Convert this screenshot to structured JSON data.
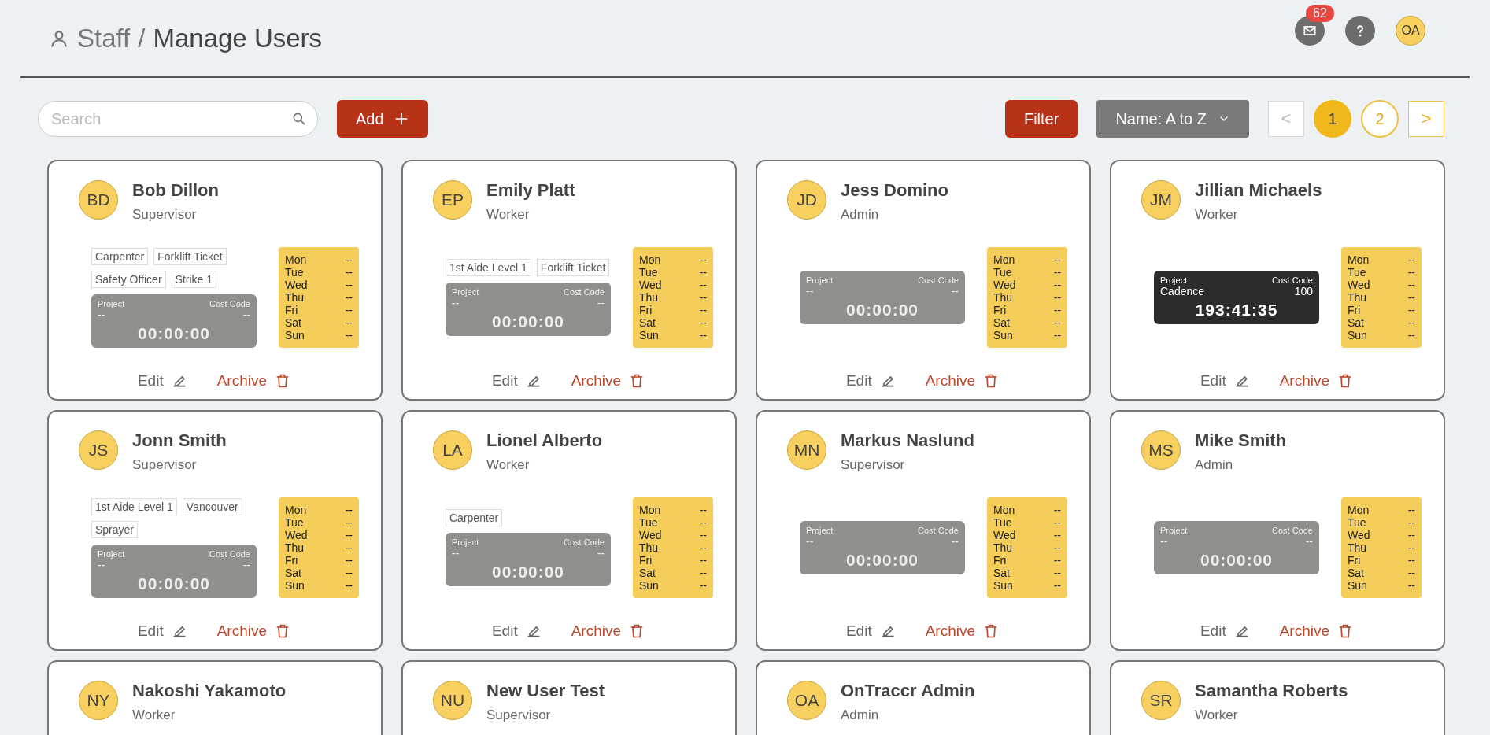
{
  "breadcrumb": {
    "section": "Staff",
    "separator": "/",
    "page": "Manage Users"
  },
  "header_actions": {
    "mail_badge": "62",
    "avatar": "OA"
  },
  "toolbar": {
    "search": {
      "placeholder": "Search"
    },
    "add_button": "Add",
    "filter_button": "Filter",
    "sort_dropdown": "Name: A to Z",
    "pagination": {
      "prev": {
        "label": "<",
        "disabled": true
      },
      "pages": [
        {
          "label": "1",
          "selected": true
        },
        {
          "label": "2",
          "selected": false
        }
      ],
      "next": {
        "label": ">",
        "disabled": false
      }
    }
  },
  "cards": [
    {
      "initials": "BD",
      "name": "Bob Dillon",
      "role": "Supervisor",
      "tags": [
        "Carpenter",
        "Forklift Ticket",
        "Safety Officer",
        "Strike 1"
      ],
      "timer": {
        "running": false,
        "project_label": "Project",
        "cost_code_label": "Cost Code",
        "project": "--",
        "cost_code": "--",
        "time": "00:00:00"
      },
      "schedule": [
        [
          "Mon",
          "--"
        ],
        [
          "Tue",
          "--"
        ],
        [
          "Wed",
          "--"
        ],
        [
          "Thu",
          "--"
        ],
        [
          "Fri",
          "--"
        ],
        [
          "Sat",
          "--"
        ],
        [
          "Sun",
          "--"
        ]
      ],
      "edit": "Edit",
      "archive": "Archive"
    },
    {
      "initials": "EP",
      "name": "Emily Platt",
      "role": "Worker",
      "tags": [
        "1st Aide Level 1",
        "Forklift Ticket"
      ],
      "timer": {
        "running": false,
        "project_label": "Project",
        "cost_code_label": "Cost Code",
        "project": "--",
        "cost_code": "--",
        "time": "00:00:00"
      },
      "schedule": [
        [
          "Mon",
          "--"
        ],
        [
          "Tue",
          "--"
        ],
        [
          "Wed",
          "--"
        ],
        [
          "Thu",
          "--"
        ],
        [
          "Fri",
          "--"
        ],
        [
          "Sat",
          "--"
        ],
        [
          "Sun",
          "--"
        ]
      ],
      "edit": "Edit",
      "archive": "Archive"
    },
    {
      "initials": "JD",
      "name": "Jess Domino",
      "role": "Admin",
      "timer": {
        "running": false,
        "project_label": "Project",
        "cost_code_label": "Cost Code",
        "project": "--",
        "cost_code": "--",
        "time": "00:00:00"
      },
      "schedule": [
        [
          "Mon",
          "--"
        ],
        [
          "Tue",
          "--"
        ],
        [
          "Wed",
          "--"
        ],
        [
          "Thu",
          "--"
        ],
        [
          "Fri",
          "--"
        ],
        [
          "Sat",
          "--"
        ],
        [
          "Sun",
          "--"
        ]
      ],
      "edit": "Edit",
      "archive": "Archive"
    },
    {
      "initials": "JM",
      "name": "Jillian Michaels",
      "role": "Worker",
      "timer": {
        "running": true,
        "project_label": "Project",
        "cost_code_label": "Cost Code",
        "project": "Cadence",
        "cost_code": "100",
        "time": "193:41:35"
      },
      "schedule": [
        [
          "Mon",
          "--"
        ],
        [
          "Tue",
          "--"
        ],
        [
          "Wed",
          "--"
        ],
        [
          "Thu",
          "--"
        ],
        [
          "Fri",
          "--"
        ],
        [
          "Sat",
          "--"
        ],
        [
          "Sun",
          "--"
        ]
      ],
      "edit": "Edit",
      "archive": "Archive"
    },
    {
      "initials": "JS",
      "name": "Jonn Smith",
      "role": "Supervisor",
      "tags": [
        "1st Aide Level 1",
        "Vancouver",
        "Sprayer"
      ],
      "timer": {
        "running": false,
        "project_label": "Project",
        "cost_code_label": "Cost Code",
        "project": "--",
        "cost_code": "--",
        "time": "00:00:00"
      },
      "schedule": [
        [
          "Mon",
          "--"
        ],
        [
          "Tue",
          "--"
        ],
        [
          "Wed",
          "--"
        ],
        [
          "Thu",
          "--"
        ],
        [
          "Fri",
          "--"
        ],
        [
          "Sat",
          "--"
        ],
        [
          "Sun",
          "--"
        ]
      ],
      "edit": "Edit",
      "archive": "Archive"
    },
    {
      "initials": "LA",
      "name": "Lionel Alberto",
      "role": "Worker",
      "tags": [
        "Carpenter"
      ],
      "timer": {
        "running": false,
        "project_label": "Project",
        "cost_code_label": "Cost Code",
        "project": "--",
        "cost_code": "--",
        "time": "00:00:00"
      },
      "schedule": [
        [
          "Mon",
          "--"
        ],
        [
          "Tue",
          "--"
        ],
        [
          "Wed",
          "--"
        ],
        [
          "Thu",
          "--"
        ],
        [
          "Fri",
          "--"
        ],
        [
          "Sat",
          "--"
        ],
        [
          "Sun",
          "--"
        ]
      ],
      "edit": "Edit",
      "archive": "Archive"
    },
    {
      "initials": "MN",
      "name": "Markus Naslund",
      "role": "Supervisor",
      "timer": {
        "running": false,
        "project_label": "Project",
        "cost_code_label": "Cost Code",
        "project": "--",
        "cost_code": "--",
        "time": "00:00:00"
      },
      "schedule": [
        [
          "Mon",
          "--"
        ],
        [
          "Tue",
          "--"
        ],
        [
          "Wed",
          "--"
        ],
        [
          "Thu",
          "--"
        ],
        [
          "Fri",
          "--"
        ],
        [
          "Sat",
          "--"
        ],
        [
          "Sun",
          "--"
        ]
      ],
      "edit": "Edit",
      "archive": "Archive"
    },
    {
      "initials": "MS",
      "name": "Mike Smith",
      "role": "Admin",
      "timer": {
        "running": false,
        "project_label": "Project",
        "cost_code_label": "Cost Code",
        "project": "--",
        "cost_code": "--",
        "time": "00:00:00"
      },
      "schedule": [
        [
          "Mon",
          "--"
        ],
        [
          "Tue",
          "--"
        ],
        [
          "Wed",
          "--"
        ],
        [
          "Thu",
          "--"
        ],
        [
          "Fri",
          "--"
        ],
        [
          "Sat",
          "--"
        ],
        [
          "Sun",
          "--"
        ]
      ],
      "edit": "Edit",
      "archive": "Archive"
    },
    {
      "initials": "NY",
      "name": "Nakoshi Yakamoto",
      "role": "Worker"
    },
    {
      "initials": "NU",
      "name": "New User Test",
      "role": "Supervisor"
    },
    {
      "initials": "OA",
      "name": "OnTraccr Admin",
      "role": "Admin"
    },
    {
      "initials": "SR",
      "name": "Samantha Roberts",
      "role": "Worker"
    }
  ]
}
